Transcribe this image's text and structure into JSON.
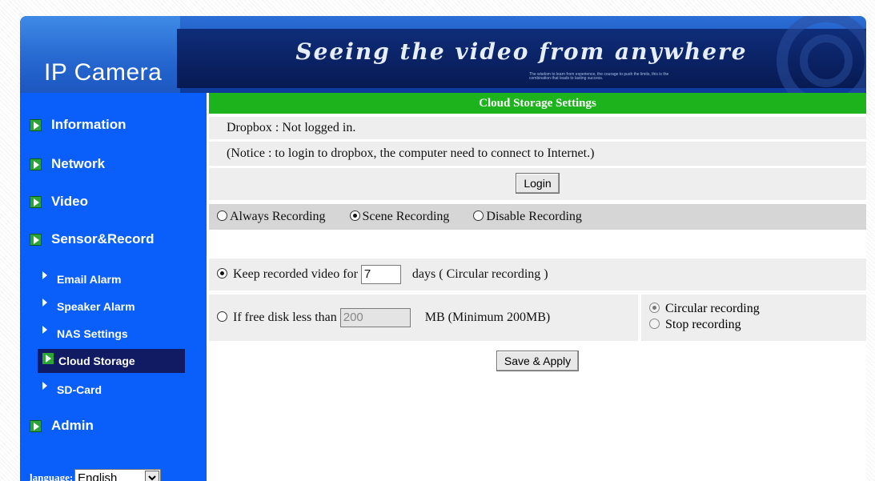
{
  "header": {
    "logo": "IP Camera",
    "tagline": "Seeing the video from anywhere",
    "fineprint": "The wisdom to learn from experience, the courage to push the limits, this is the combination that leads to lasting success."
  },
  "sidebar": {
    "items": [
      {
        "label": "Information"
      },
      {
        "label": "Network"
      },
      {
        "label": "Video"
      },
      {
        "label": "Sensor&Record"
      }
    ],
    "subitems": [
      {
        "label": "Email Alarm"
      },
      {
        "label": "Speaker Alarm"
      },
      {
        "label": "NAS Settings"
      },
      {
        "label": "Cloud Storage"
      },
      {
        "label": "SD-Card"
      }
    ],
    "admin": "Admin",
    "language_label": "language:",
    "language_value": "English"
  },
  "main": {
    "title": "Cloud Storage Settings",
    "dropbox_status": "Dropbox : Not logged in.",
    "notice": "(Notice : to login to dropbox, the computer need to connect to Internet.)",
    "login_button": "Login",
    "recording_options": [
      "Always Recording",
      "Scene Recording",
      "Disable Recording"
    ],
    "selected_recording": "Scene Recording",
    "keep_label": "Keep recorded video for",
    "keep_days": "7",
    "keep_suffix": "days ( Circular recording )",
    "free_disk_label": "If free disk less than",
    "free_disk_value": "200",
    "free_disk_suffix": "MB (Minimum 200MB)",
    "circular_label": "Circular recording",
    "stop_label": "Stop recording",
    "save_button": "Save & Apply"
  },
  "colors": {
    "sidebar": "#0a5ffa",
    "title_bar": "#1db31d",
    "active_subitem": "#101b63"
  }
}
